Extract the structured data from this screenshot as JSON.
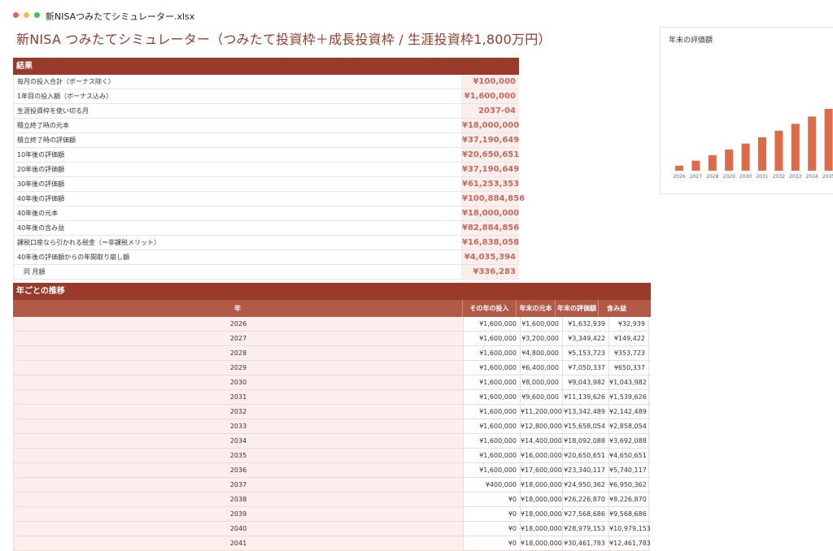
{
  "window": {
    "filename": "新NISAつみたてシミュレーター.xlsx",
    "dot_colors": [
      "#f25f58",
      "#f8bd3a",
      "#3ec54f"
    ]
  },
  "page_title": "新NISA つみたてシミュレーター（つみたて投資枠＋成長投資枠 / 生涯投資枠1,800万円）",
  "results": {
    "header": "結果",
    "rows": [
      {
        "label": "毎月の投入合計（ボーナス除く）",
        "value": "¥100,000"
      },
      {
        "label": "1年目の投入額（ボーナス込み）",
        "value": "¥1,600,000"
      },
      {
        "label": "生涯投資枠を使い切る月",
        "value": "2037-04"
      },
      {
        "label": "積立終了時の元本",
        "value": "¥18,000,000"
      },
      {
        "label": "積立終了時の評価額",
        "value": "¥37,190,649"
      },
      {
        "label": "10年後の評価額",
        "value": "¥20,650,651"
      },
      {
        "label": "20年後の評価額",
        "value": "¥37,190,649"
      },
      {
        "label": "30年後の評価額",
        "value": "¥61,253,353"
      },
      {
        "label": "40年後の評価額",
        "value": "¥100,884,856"
      },
      {
        "label": "40年後の元本",
        "value": "¥18,000,000"
      },
      {
        "label": "40年後の含み益",
        "value": "¥82,884,856"
      },
      {
        "label": "課税口座なら引かれる税金（＝非課税メリット）",
        "value": "¥16,838,058"
      },
      {
        "label": "40年後の評価額からの年間取り崩し額",
        "value": "¥4,035,394"
      },
      {
        "label": "同 月額",
        "value": "¥336,283"
      }
    ]
  },
  "transition": {
    "header": "年ごとの推移",
    "columns": [
      "年",
      "その年の投入",
      "年末の元本",
      "年末の評価額",
      "含み益"
    ],
    "rows": [
      [
        "2026",
        "¥1,600,000",
        "¥1,600,000",
        "¥1,632,939",
        "¥32,939"
      ],
      [
        "2027",
        "¥1,600,000",
        "¥3,200,000",
        "¥3,349,422",
        "¥149,422"
      ],
      [
        "2028",
        "¥1,600,000",
        "¥4,800,000",
        "¥5,153,723",
        "¥353,723"
      ],
      [
        "2029",
        "¥1,600,000",
        "¥6,400,000",
        "¥7,050,337",
        "¥650,337"
      ],
      [
        "2030",
        "¥1,600,000",
        "¥8,000,000",
        "¥9,043,982",
        "¥1,043,982"
      ],
      [
        "2031",
        "¥1,600,000",
        "¥9,600,000",
        "¥11,139,626",
        "¥1,539,626"
      ],
      [
        "2032",
        "¥1,600,000",
        "¥11,200,000",
        "¥13,342,489",
        "¥2,142,489"
      ],
      [
        "2033",
        "¥1,600,000",
        "¥12,800,000",
        "¥15,658,054",
        "¥2,858,054"
      ],
      [
        "2034",
        "¥1,600,000",
        "¥14,400,000",
        "¥18,092,088",
        "¥3,692,088"
      ],
      [
        "2035",
        "¥1,600,000",
        "¥16,000,000",
        "¥20,650,651",
        "¥4,650,651"
      ],
      [
        "2036",
        "¥1,600,000",
        "¥17,600,000",
        "¥23,340,117",
        "¥5,740,117"
      ],
      [
        "2037",
        "¥400,000",
        "¥18,000,000",
        "¥24,950,362",
        "¥6,950,362"
      ],
      [
        "2038",
        "¥0",
        "¥18,000,000",
        "¥26,226,870",
        "¥8,226,870"
      ],
      [
        "2039",
        "¥0",
        "¥18,000,000",
        "¥27,568,686",
        "¥9,568,686"
      ],
      [
        "2040",
        "¥0",
        "¥18,000,000",
        "¥28,979,153",
        "¥10,979,153"
      ],
      [
        "2041",
        "¥0",
        "¥18,000,000",
        "¥30,461,783",
        "¥12,461,783"
      ]
    ]
  },
  "chart_data": {
    "type": "bar",
    "title": "年末の評価額",
    "categories": [
      "2026",
      "2027",
      "2028",
      "2029",
      "2030",
      "2031",
      "2032",
      "2033",
      "2034",
      "2035"
    ],
    "values": [
      1632939,
      3349422,
      5153723,
      7050337,
      9043982,
      11139626,
      13342489,
      15658054,
      18092088,
      20650651
    ],
    "ylim": [
      0,
      25000000
    ],
    "grid": false,
    "color": "#dd6a48"
  }
}
